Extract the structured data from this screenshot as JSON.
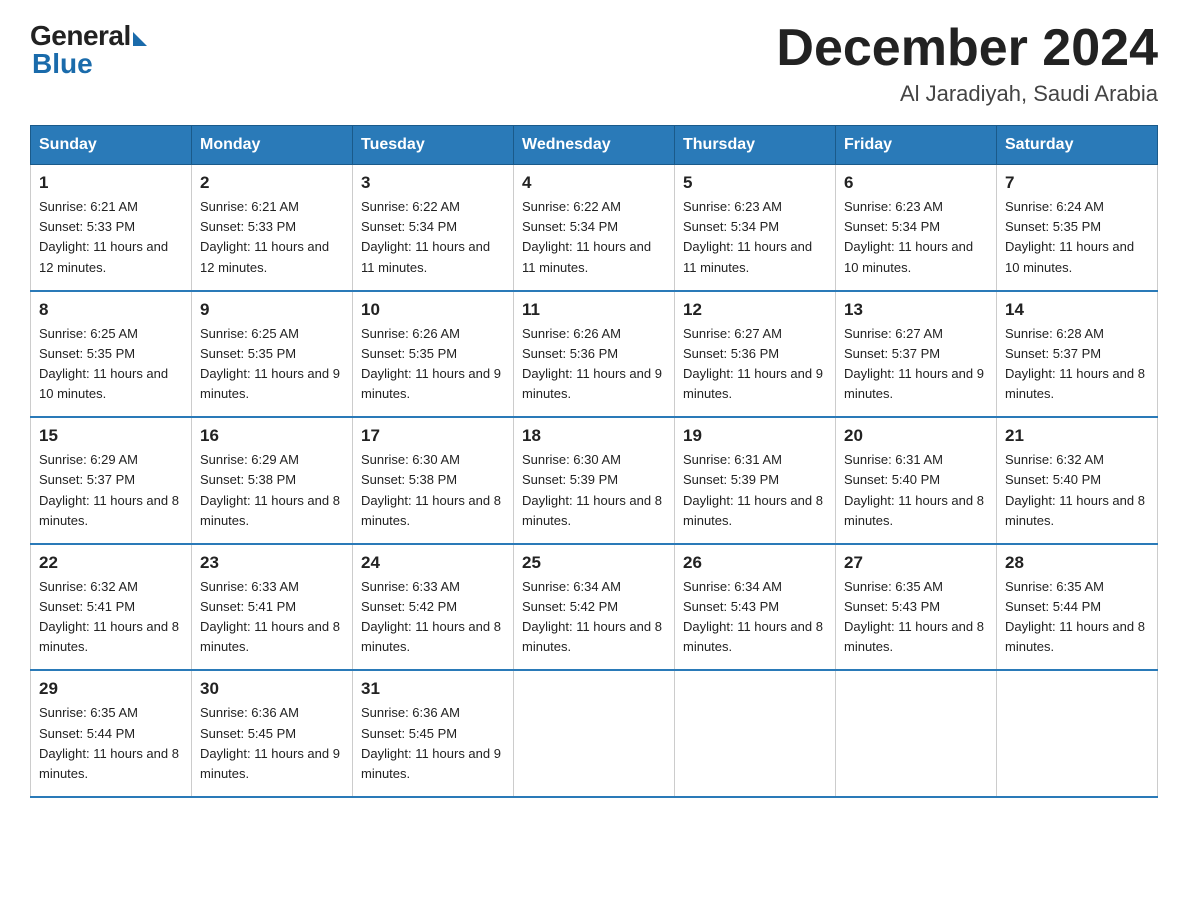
{
  "logo": {
    "general": "General",
    "blue": "Blue"
  },
  "title": "December 2024",
  "location": "Al Jaradiyah, Saudi Arabia",
  "days_of_week": [
    "Sunday",
    "Monday",
    "Tuesday",
    "Wednesday",
    "Thursday",
    "Friday",
    "Saturday"
  ],
  "weeks": [
    [
      {
        "day": "1",
        "sunrise": "6:21 AM",
        "sunset": "5:33 PM",
        "daylight": "11 hours and 12 minutes."
      },
      {
        "day": "2",
        "sunrise": "6:21 AM",
        "sunset": "5:33 PM",
        "daylight": "11 hours and 12 minutes."
      },
      {
        "day": "3",
        "sunrise": "6:22 AM",
        "sunset": "5:34 PM",
        "daylight": "11 hours and 11 minutes."
      },
      {
        "day": "4",
        "sunrise": "6:22 AM",
        "sunset": "5:34 PM",
        "daylight": "11 hours and 11 minutes."
      },
      {
        "day": "5",
        "sunrise": "6:23 AM",
        "sunset": "5:34 PM",
        "daylight": "11 hours and 11 minutes."
      },
      {
        "day": "6",
        "sunrise": "6:23 AM",
        "sunset": "5:34 PM",
        "daylight": "11 hours and 10 minutes."
      },
      {
        "day": "7",
        "sunrise": "6:24 AM",
        "sunset": "5:35 PM",
        "daylight": "11 hours and 10 minutes."
      }
    ],
    [
      {
        "day": "8",
        "sunrise": "6:25 AM",
        "sunset": "5:35 PM",
        "daylight": "11 hours and 10 minutes."
      },
      {
        "day": "9",
        "sunrise": "6:25 AM",
        "sunset": "5:35 PM",
        "daylight": "11 hours and 9 minutes."
      },
      {
        "day": "10",
        "sunrise": "6:26 AM",
        "sunset": "5:35 PM",
        "daylight": "11 hours and 9 minutes."
      },
      {
        "day": "11",
        "sunrise": "6:26 AM",
        "sunset": "5:36 PM",
        "daylight": "11 hours and 9 minutes."
      },
      {
        "day": "12",
        "sunrise": "6:27 AM",
        "sunset": "5:36 PM",
        "daylight": "11 hours and 9 minutes."
      },
      {
        "day": "13",
        "sunrise": "6:27 AM",
        "sunset": "5:37 PM",
        "daylight": "11 hours and 9 minutes."
      },
      {
        "day": "14",
        "sunrise": "6:28 AM",
        "sunset": "5:37 PM",
        "daylight": "11 hours and 8 minutes."
      }
    ],
    [
      {
        "day": "15",
        "sunrise": "6:29 AM",
        "sunset": "5:37 PM",
        "daylight": "11 hours and 8 minutes."
      },
      {
        "day": "16",
        "sunrise": "6:29 AM",
        "sunset": "5:38 PM",
        "daylight": "11 hours and 8 minutes."
      },
      {
        "day": "17",
        "sunrise": "6:30 AM",
        "sunset": "5:38 PM",
        "daylight": "11 hours and 8 minutes."
      },
      {
        "day": "18",
        "sunrise": "6:30 AM",
        "sunset": "5:39 PM",
        "daylight": "11 hours and 8 minutes."
      },
      {
        "day": "19",
        "sunrise": "6:31 AM",
        "sunset": "5:39 PM",
        "daylight": "11 hours and 8 minutes."
      },
      {
        "day": "20",
        "sunrise": "6:31 AM",
        "sunset": "5:40 PM",
        "daylight": "11 hours and 8 minutes."
      },
      {
        "day": "21",
        "sunrise": "6:32 AM",
        "sunset": "5:40 PM",
        "daylight": "11 hours and 8 minutes."
      }
    ],
    [
      {
        "day": "22",
        "sunrise": "6:32 AM",
        "sunset": "5:41 PM",
        "daylight": "11 hours and 8 minutes."
      },
      {
        "day": "23",
        "sunrise": "6:33 AM",
        "sunset": "5:41 PM",
        "daylight": "11 hours and 8 minutes."
      },
      {
        "day": "24",
        "sunrise": "6:33 AM",
        "sunset": "5:42 PM",
        "daylight": "11 hours and 8 minutes."
      },
      {
        "day": "25",
        "sunrise": "6:34 AM",
        "sunset": "5:42 PM",
        "daylight": "11 hours and 8 minutes."
      },
      {
        "day": "26",
        "sunrise": "6:34 AM",
        "sunset": "5:43 PM",
        "daylight": "11 hours and 8 minutes."
      },
      {
        "day": "27",
        "sunrise": "6:35 AM",
        "sunset": "5:43 PM",
        "daylight": "11 hours and 8 minutes."
      },
      {
        "day": "28",
        "sunrise": "6:35 AM",
        "sunset": "5:44 PM",
        "daylight": "11 hours and 8 minutes."
      }
    ],
    [
      {
        "day": "29",
        "sunrise": "6:35 AM",
        "sunset": "5:44 PM",
        "daylight": "11 hours and 8 minutes."
      },
      {
        "day": "30",
        "sunrise": "6:36 AM",
        "sunset": "5:45 PM",
        "daylight": "11 hours and 9 minutes."
      },
      {
        "day": "31",
        "sunrise": "6:36 AM",
        "sunset": "5:45 PM",
        "daylight": "11 hours and 9 minutes."
      },
      null,
      null,
      null,
      null
    ]
  ]
}
